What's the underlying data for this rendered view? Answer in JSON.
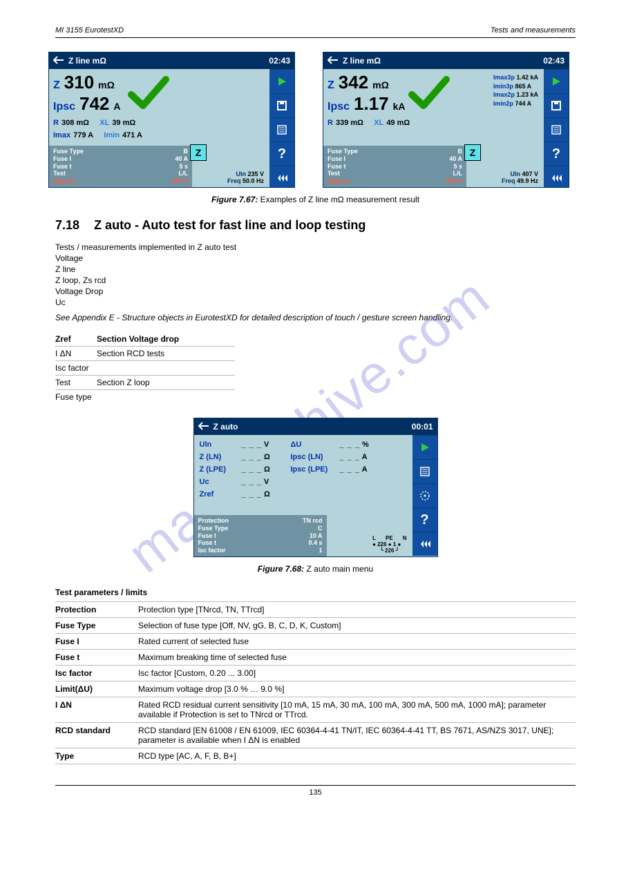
{
  "header": {
    "left": "MI 3155 EurotestXD",
    "right": "Tests and measurements"
  },
  "footer": "135",
  "watermark": "manualshive.com",
  "screenLeft": {
    "title": "Z line mΩ",
    "clock": "02:43",
    "Z": {
      "label": "Z",
      "value": "310",
      "unit": "mΩ"
    },
    "Ipsc": {
      "label": "Ipsc",
      "value": "742",
      "unit": "A"
    },
    "row1": {
      "R": {
        "label": "R",
        "val": "308 mΩ"
      },
      "XL": {
        "label": "XL",
        "val": "39 mΩ"
      }
    },
    "row2": {
      "Imax": {
        "label": "Imax",
        "val": "779 A"
      },
      "Imin": {
        "label": "Imin",
        "val": "471 A"
      }
    },
    "fuse": {
      "FuseType": {
        "label": "Fuse Type",
        "val": "B"
      },
      "FuseI": {
        "label": "Fuse I",
        "val": "40 A"
      },
      "FuseT": {
        "label": "Fuse t",
        "val": "5 s"
      },
      "Test": {
        "label": "Test",
        "val": "L/L"
      },
      "Ia": {
        "label": "Ia(Ipsc)",
        "val": "200 A"
      }
    },
    "uln": {
      "label": "Uln",
      "val": "235 V"
    },
    "freq": {
      "label": "Freq",
      "val": "50.0 Hz"
    },
    "zbadge": "Z"
  },
  "screenRight": {
    "title": "Z line mΩ",
    "clock": "02:43",
    "Z": {
      "label": "Z",
      "value": "342",
      "unit": "mΩ"
    },
    "Ipsc": {
      "label": "Ipsc",
      "value": "1.17",
      "unit": "kA"
    },
    "row1": {
      "R": {
        "label": "R",
        "val": "339 mΩ"
      },
      "XL": {
        "label": "XL",
        "val": "49 mΩ"
      }
    },
    "side": {
      "Imax3p": {
        "label": "Imax3p",
        "val": "1.42 kA"
      },
      "Imin3p": {
        "label": "Imin3p",
        "val": "865 A"
      },
      "Imax2p": {
        "label": "Imax2p",
        "val": "1.23 kA"
      },
      "Imin2p": {
        "label": "Imin2p",
        "val": "744 A"
      }
    },
    "fuse": {
      "FuseType": {
        "label": "Fuse Type",
        "val": "B"
      },
      "FuseI": {
        "label": "Fuse I",
        "val": "40 A"
      },
      "FuseT": {
        "label": "Fuse t",
        "val": "5 s"
      },
      "Test": {
        "label": "Test",
        "val": "L/L"
      },
      "Ia": {
        "label": "Ia(Ipsc)",
        "val": "200 A"
      }
    },
    "uln": {
      "label": "Uln",
      "val": "407 V"
    },
    "freq": {
      "label": "Freq",
      "val": "49.9 Hz"
    },
    "zbadge": "Z"
  },
  "caption1": {
    "num": "Figure 7.67:",
    "text": "Examples of Z line mΩ measurement result"
  },
  "section": {
    "num": "7.18",
    "title": "Z auto - Auto test for fast line and loop testing"
  },
  "intro": {
    "line1": "Tests / measurements implemented in Z auto test",
    "line2": "Voltage",
    "line3": "Z line",
    "line4": "Z loop, Zs rcd",
    "line5": "Voltage Drop",
    "line6": "Uc"
  },
  "hint": "See Appendix E - Structure objects in EurotestXD for detailed description of touch / gesture screen handling.",
  "reftable": {
    "r1": {
      "c1": "Zref",
      "c2": "Section Voltage drop"
    },
    "r2": {
      "c1": "I ΔN",
      "c2": "Section RCD tests"
    },
    "r3": {
      "c1": "Isc factor",
      "c2": ""
    },
    "r4": {
      "c1": "Test",
      "c2": "Section Z loop"
    },
    "r5": {
      "c1": "Fuse type",
      "c2": ""
    }
  },
  "screen3": {
    "title": "Z auto",
    "clock": "00:01",
    "rows": {
      "Uln": {
        "label": "Uln",
        "placeholder": "_ _ _",
        "unit": "V"
      },
      "dU": {
        "label": "ΔU",
        "placeholder": "_ _ _",
        "unit": "%"
      },
      "ZLN": {
        "label": "Z (LN)",
        "placeholder": "_ _ _",
        "unit": "Ω"
      },
      "IpscLN": {
        "label": "Ipsc (LN)",
        "placeholder": "_ _ _",
        "unit": "A"
      },
      "ZLPE": {
        "label": "Z (LPE)",
        "placeholder": "_ _ _",
        "unit": "Ω"
      },
      "IpscLPE": {
        "label": "Ipsc (LPE)",
        "placeholder": "_ _ _",
        "unit": "A"
      },
      "Uc": {
        "label": "Uc",
        "placeholder": "_ _ _",
        "unit": "V"
      },
      "Zref": {
        "label": "Zref",
        "placeholder": "_ _ _",
        "unit": "Ω"
      }
    },
    "fuse": {
      "Prot": {
        "label": "Protection",
        "val": "TN rcd"
      },
      "FuseType": {
        "label": "Fuse Type",
        "val": "C"
      },
      "FuseI": {
        "label": "Fuse I",
        "val": "10 A"
      },
      "FuseT": {
        "label": "Fuse t",
        "val": "0.4 s"
      },
      "Isc": {
        "label": "Isc factor",
        "val": "1"
      }
    },
    "diag": {
      "L": "L",
      "PE": "PE",
      "N": "N",
      "v1": "226",
      "v2": "1",
      "v3": "226"
    }
  },
  "caption2": {
    "num": "Figure 7.68:",
    "text": "Z auto main menu"
  },
  "paramsHeader": "Test parameters / limits",
  "params": {
    "r1": {
      "k": "Protection",
      "v": "Protection type [TNrcd, TN, TTrcd]"
    },
    "r2": {
      "k": "Fuse Type",
      "v": "Selection of fuse type [Off, NV, gG, B, C, D, K, Custom]"
    },
    "r3": {
      "k": "Fuse I",
      "v": "Rated current of selected fuse"
    },
    "r4": {
      "k": "Fuse t",
      "v": "Maximum breaking time of selected fuse"
    },
    "r5": {
      "k": "Isc factor",
      "v": "Isc factor [Custom, 0.20 ... 3.00]"
    },
    "r6": {
      "k": "Limit(ΔU)",
      "v": "Maximum voltage drop [3.0 % … 9.0 %]"
    },
    "r7": {
      "k": "I ΔN",
      "v": "Rated RCD residual current sensitivity [10 mA, 15 mA, 30 mA, 100 mA, 300 mA, 500 mA, 1000 mA]; parameter available if Protection is set to TNrcd or TTrcd."
    },
    "r8": {
      "k": "RCD standard",
      "v": "RCD standard [EN 61008 / EN 61009, IEC 60364-4-41 TN/IT, IEC 60364-4-41 TT, BS 7671, AS/NZS 3017, UNE]; parameter is available when I ΔN is enabled"
    },
    "r9": {
      "k": "Type",
      "v": "RCD type [AC, A, F, B, B+]"
    }
  }
}
